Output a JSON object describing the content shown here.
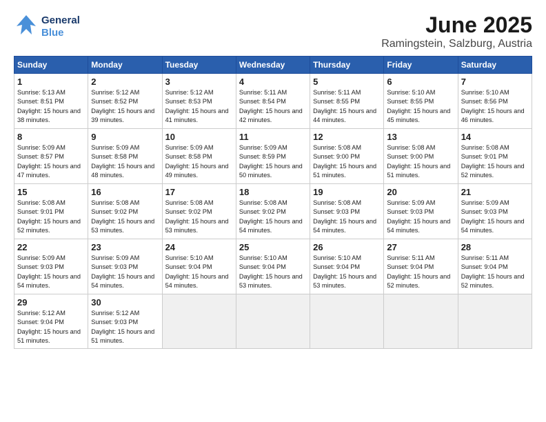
{
  "logo": {
    "line1": "General",
    "line2": "Blue"
  },
  "title": "June 2025",
  "subtitle": "Ramingstein, Salzburg, Austria",
  "weekdays": [
    "Sunday",
    "Monday",
    "Tuesday",
    "Wednesday",
    "Thursday",
    "Friday",
    "Saturday"
  ],
  "weeks": [
    [
      {
        "day": 1,
        "sunrise": "5:13 AM",
        "sunset": "8:51 PM",
        "daylight": "15 hours and 38 minutes."
      },
      {
        "day": 2,
        "sunrise": "5:12 AM",
        "sunset": "8:52 PM",
        "daylight": "15 hours and 39 minutes."
      },
      {
        "day": 3,
        "sunrise": "5:12 AM",
        "sunset": "8:53 PM",
        "daylight": "15 hours and 41 minutes."
      },
      {
        "day": 4,
        "sunrise": "5:11 AM",
        "sunset": "8:54 PM",
        "daylight": "15 hours and 42 minutes."
      },
      {
        "day": 5,
        "sunrise": "5:11 AM",
        "sunset": "8:55 PM",
        "daylight": "15 hours and 44 minutes."
      },
      {
        "day": 6,
        "sunrise": "5:10 AM",
        "sunset": "8:55 PM",
        "daylight": "15 hours and 45 minutes."
      },
      {
        "day": 7,
        "sunrise": "5:10 AM",
        "sunset": "8:56 PM",
        "daylight": "15 hours and 46 minutes."
      }
    ],
    [
      {
        "day": 8,
        "sunrise": "5:09 AM",
        "sunset": "8:57 PM",
        "daylight": "15 hours and 47 minutes."
      },
      {
        "day": 9,
        "sunrise": "5:09 AM",
        "sunset": "8:58 PM",
        "daylight": "15 hours and 48 minutes."
      },
      {
        "day": 10,
        "sunrise": "5:09 AM",
        "sunset": "8:58 PM",
        "daylight": "15 hours and 49 minutes."
      },
      {
        "day": 11,
        "sunrise": "5:09 AM",
        "sunset": "8:59 PM",
        "daylight": "15 hours and 50 minutes."
      },
      {
        "day": 12,
        "sunrise": "5:08 AM",
        "sunset": "9:00 PM",
        "daylight": "15 hours and 51 minutes."
      },
      {
        "day": 13,
        "sunrise": "5:08 AM",
        "sunset": "9:00 PM",
        "daylight": "15 hours and 51 minutes."
      },
      {
        "day": 14,
        "sunrise": "5:08 AM",
        "sunset": "9:01 PM",
        "daylight": "15 hours and 52 minutes."
      }
    ],
    [
      {
        "day": 15,
        "sunrise": "5:08 AM",
        "sunset": "9:01 PM",
        "daylight": "15 hours and 52 minutes."
      },
      {
        "day": 16,
        "sunrise": "5:08 AM",
        "sunset": "9:02 PM",
        "daylight": "15 hours and 53 minutes."
      },
      {
        "day": 17,
        "sunrise": "5:08 AM",
        "sunset": "9:02 PM",
        "daylight": "15 hours and 53 minutes."
      },
      {
        "day": 18,
        "sunrise": "5:08 AM",
        "sunset": "9:02 PM",
        "daylight": "15 hours and 54 minutes."
      },
      {
        "day": 19,
        "sunrise": "5:08 AM",
        "sunset": "9:03 PM",
        "daylight": "15 hours and 54 minutes."
      },
      {
        "day": 20,
        "sunrise": "5:09 AM",
        "sunset": "9:03 PM",
        "daylight": "15 hours and 54 minutes."
      },
      {
        "day": 21,
        "sunrise": "5:09 AM",
        "sunset": "9:03 PM",
        "daylight": "15 hours and 54 minutes."
      }
    ],
    [
      {
        "day": 22,
        "sunrise": "5:09 AM",
        "sunset": "9:03 PM",
        "daylight": "15 hours and 54 minutes."
      },
      {
        "day": 23,
        "sunrise": "5:09 AM",
        "sunset": "9:03 PM",
        "daylight": "15 hours and 54 minutes."
      },
      {
        "day": 24,
        "sunrise": "5:10 AM",
        "sunset": "9:04 PM",
        "daylight": "15 hours and 54 minutes."
      },
      {
        "day": 25,
        "sunrise": "5:10 AM",
        "sunset": "9:04 PM",
        "daylight": "15 hours and 53 minutes."
      },
      {
        "day": 26,
        "sunrise": "5:10 AM",
        "sunset": "9:04 PM",
        "daylight": "15 hours and 53 minutes."
      },
      {
        "day": 27,
        "sunrise": "5:11 AM",
        "sunset": "9:04 PM",
        "daylight": "15 hours and 52 minutes."
      },
      {
        "day": 28,
        "sunrise": "5:11 AM",
        "sunset": "9:04 PM",
        "daylight": "15 hours and 52 minutes."
      }
    ],
    [
      {
        "day": 29,
        "sunrise": "5:12 AM",
        "sunset": "9:04 PM",
        "daylight": "15 hours and 51 minutes."
      },
      {
        "day": 30,
        "sunrise": "5:12 AM",
        "sunset": "9:03 PM",
        "daylight": "15 hours and 51 minutes."
      },
      null,
      null,
      null,
      null,
      null
    ]
  ]
}
